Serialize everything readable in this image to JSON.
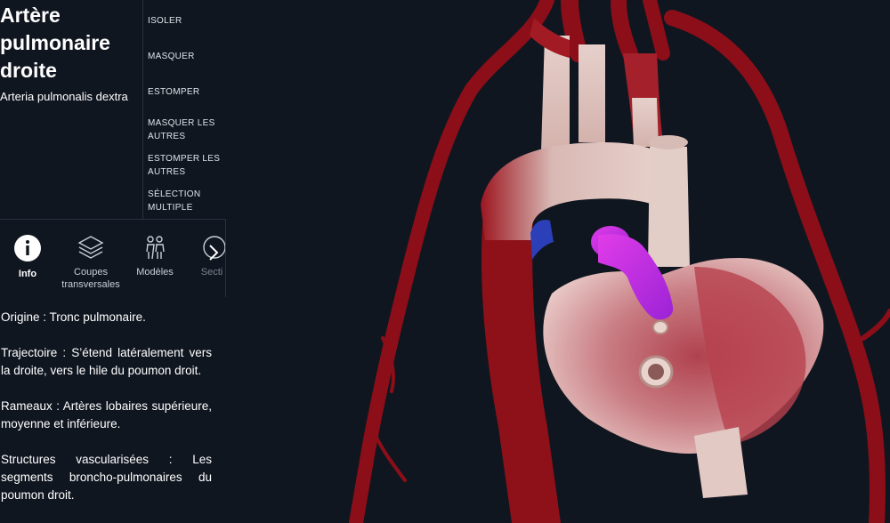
{
  "structure": {
    "title": "Artère pulmonaire droite",
    "latin": "Arteria pulmonalis dextra"
  },
  "actions": [
    "ISOLER",
    "MASQUER",
    "ESTOMPER",
    "MASQUER LES AUTRES",
    "ESTOMPER LES AUTRES",
    "SÉLECTION MULTIPLE"
  ],
  "tabs": [
    {
      "label": "Info",
      "icon": "info-icon"
    },
    {
      "label": "Coupes transversales",
      "icon": "layers-icon"
    },
    {
      "label": "Modèles",
      "icon": "people-icon"
    },
    {
      "label": "Secti",
      "icon": "cross-section-icon"
    }
  ],
  "tab_scroll_icon": "chevron-right-icon",
  "description": [
    "Origine : Tronc pulmonaire.",
    "Trajectoire : S’étend latéralement vers la droite, vers le hile du poumon droit.",
    "Rameaux : Artères lobaires supérieure, moyenne et inférieure.",
    "Structures vascularisées : Les segments broncho-pulmonaires du poumon droit."
  ],
  "colors": {
    "background": "#101620",
    "artery": "#8c0e18",
    "highlight": "#c02ad8",
    "vein_blue": "#2a3fb8",
    "heart_tissue": "#c9848a"
  }
}
